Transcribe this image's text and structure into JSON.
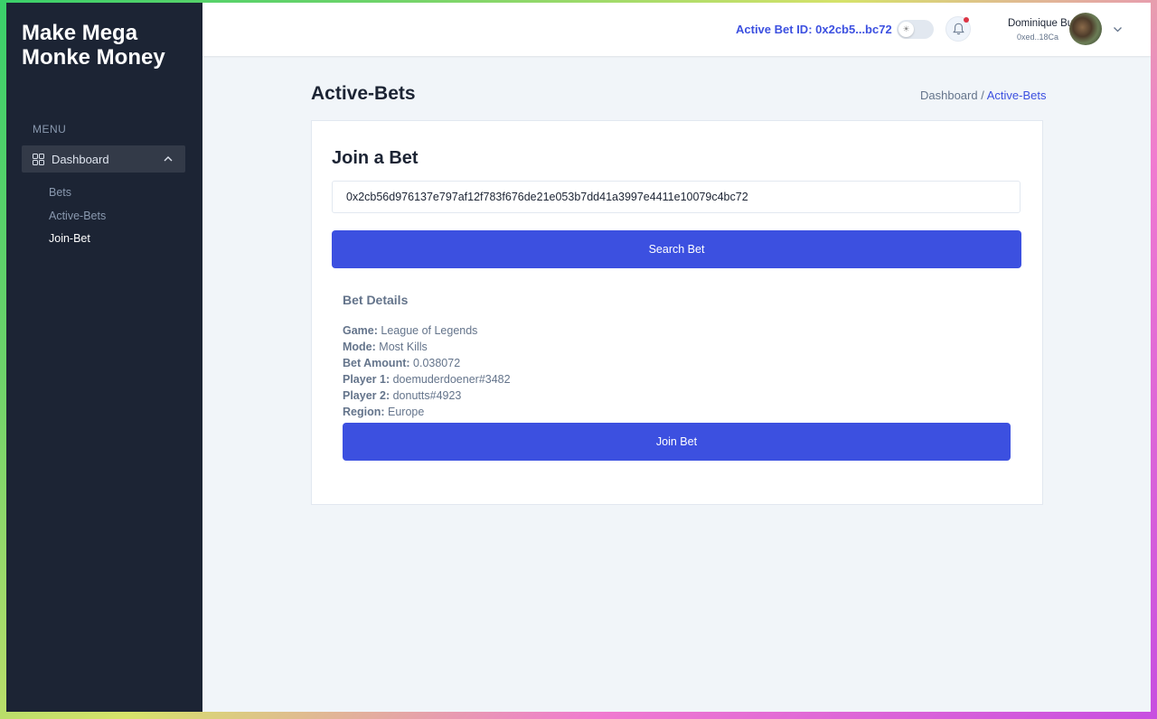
{
  "sidebar": {
    "brand": "Make Mega Monke Money",
    "menu_label": "MENU",
    "group_label": "Dashboard",
    "items": [
      {
        "label": "Bets"
      },
      {
        "label": "Active-Bets"
      },
      {
        "label": "Join-Bet"
      }
    ]
  },
  "header": {
    "active_bet": "Active Bet ID: 0x2cb5...bc72",
    "user_name": "Dominique Buob",
    "user_address": "0xed..18Ca"
  },
  "page": {
    "title": "Active-Bets",
    "breadcrumb": {
      "parent": "Dashboard /",
      "current": "Active-Bets"
    }
  },
  "card": {
    "title": "Join a Bet",
    "input_value": "0x2cb56d976137e797af12f783f676de21e053b7dd41a3997e4411e10079c4bc72",
    "search_button": "Search Bet",
    "details_title": "Bet Details",
    "details": [
      {
        "label": "Game:",
        "value": "League of Legends"
      },
      {
        "label": "Mode:",
        "value": "Most Kills"
      },
      {
        "label": "Bet Amount:",
        "value": "0.038072"
      },
      {
        "label": "Player 1:",
        "value": "doemuderdoener#3482"
      },
      {
        "label": "Player 2:",
        "value": "donutts#4923"
      },
      {
        "label": "Region:",
        "value": "Europe"
      }
    ],
    "join_button": "Join Bet"
  },
  "icons": {
    "dashboard": "grid-icon",
    "group_toggle": "chevron-up-icon",
    "theme": "sun-icon",
    "notifications": "bell-icon",
    "user_menu": "chevron-down-icon"
  },
  "colors": {
    "accent": "#3c50e0",
    "sidebar_bg": "#1c2434",
    "notification_dot": "#dc3545"
  }
}
